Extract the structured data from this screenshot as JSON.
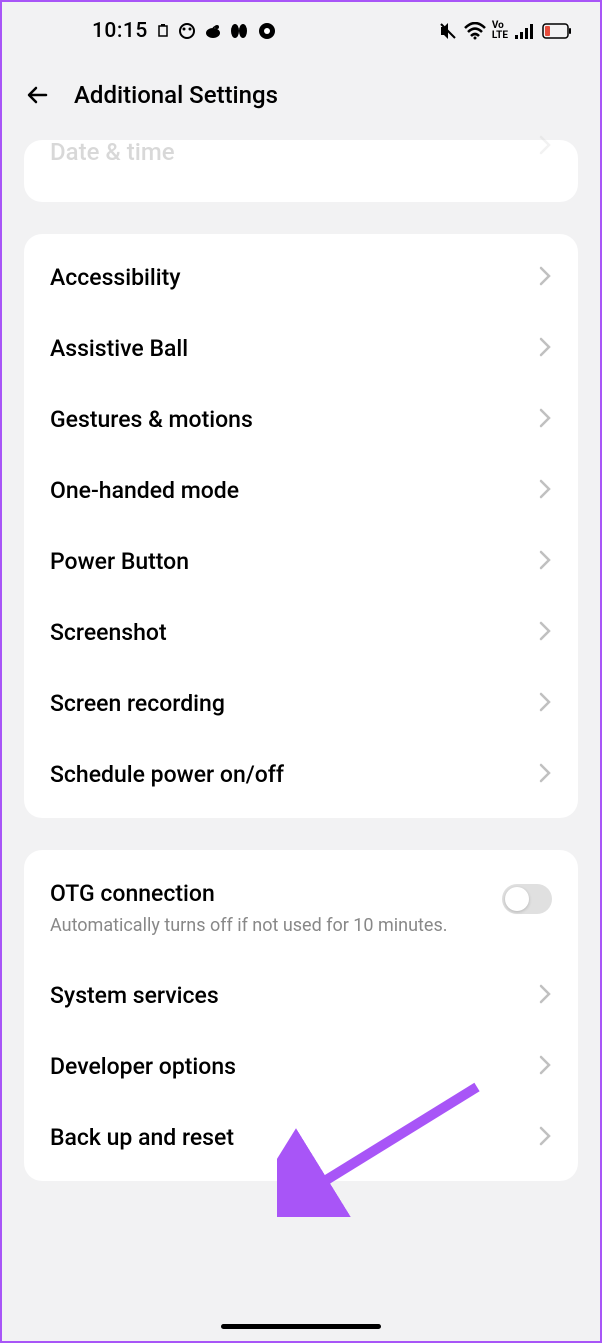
{
  "statusBar": {
    "time": "10:15"
  },
  "header": {
    "title": "Additional Settings"
  },
  "partialItem": "Date & time",
  "group1": {
    "items": [
      {
        "label": "Accessibility"
      },
      {
        "label": "Assistive Ball"
      },
      {
        "label": "Gestures & motions"
      },
      {
        "label": "One-handed mode"
      },
      {
        "label": "Power Button"
      },
      {
        "label": "Screenshot"
      },
      {
        "label": "Screen recording"
      },
      {
        "label": "Schedule power on/off"
      }
    ]
  },
  "group2": {
    "otg": {
      "label": "OTG connection",
      "sublabel": "Automatically turns off if not used for 10 minutes.",
      "enabled": false
    },
    "items": [
      {
        "label": "System services"
      },
      {
        "label": "Developer options"
      },
      {
        "label": "Back up and reset"
      }
    ]
  }
}
